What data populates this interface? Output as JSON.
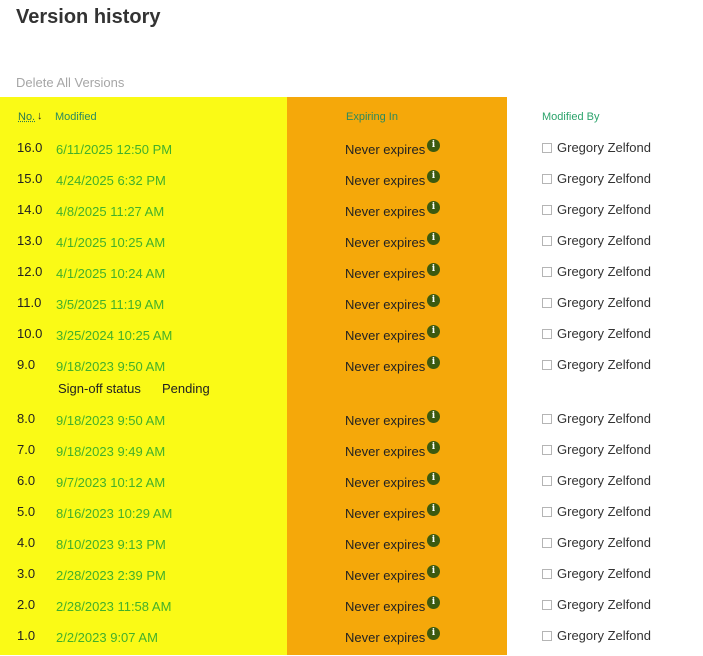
{
  "page": {
    "title": "Version history",
    "delete_all_label": "Delete All Versions"
  },
  "columns": {
    "no": "No.",
    "modified": "Modified",
    "expiring_in": "Expiring In",
    "modified_by": "Modified By"
  },
  "colors": {
    "highlight_yellow": "#fafa16",
    "highlight_orange": "#f5a80a",
    "link_green": "#43b02a"
  },
  "signoff": {
    "label": "Sign-off status",
    "value": "Pending"
  },
  "rows": [
    {
      "no": "16.0",
      "modified": "6/11/2025 12:50 PM",
      "expiring": "Never expires",
      "by": "Gregory Zelfond"
    },
    {
      "no": "15.0",
      "modified": "4/24/2025 6:32 PM",
      "expiring": "Never expires",
      "by": "Gregory Zelfond"
    },
    {
      "no": "14.0",
      "modified": "4/8/2025 11:27 AM",
      "expiring": "Never expires",
      "by": "Gregory Zelfond"
    },
    {
      "no": "13.0",
      "modified": "4/1/2025 10:25 AM",
      "expiring": "Never expires",
      "by": "Gregory Zelfond"
    },
    {
      "no": "12.0",
      "modified": "4/1/2025 10:24 AM",
      "expiring": "Never expires",
      "by": "Gregory Zelfond"
    },
    {
      "no": "11.0",
      "modified": "3/5/2025 11:19 AM",
      "expiring": "Never expires",
      "by": "Gregory Zelfond"
    },
    {
      "no": "10.0",
      "modified": "3/25/2024 10:25 AM",
      "expiring": "Never expires",
      "by": "Gregory Zelfond"
    },
    {
      "no": "9.0",
      "modified": "9/18/2023 9:50 AM",
      "expiring": "Never expires",
      "by": "Gregory Zelfond"
    },
    {
      "no": "8.0",
      "modified": "9/18/2023 9:50 AM",
      "expiring": "Never expires",
      "by": "Gregory Zelfond"
    },
    {
      "no": "7.0",
      "modified": "9/18/2023 9:49 AM",
      "expiring": "Never expires",
      "by": "Gregory Zelfond"
    },
    {
      "no": "6.0",
      "modified": "9/7/2023 10:12 AM",
      "expiring": "Never expires",
      "by": "Gregory Zelfond"
    },
    {
      "no": "5.0",
      "modified": "8/16/2023 10:29 AM",
      "expiring": "Never expires",
      "by": "Gregory Zelfond"
    },
    {
      "no": "4.0",
      "modified": "8/10/2023 9:13 PM",
      "expiring": "Never expires",
      "by": "Gregory Zelfond"
    },
    {
      "no": "3.0",
      "modified": "2/28/2023 2:39 PM",
      "expiring": "Never expires",
      "by": "Gregory Zelfond"
    },
    {
      "no": "2.0",
      "modified": "2/28/2023 11:58 AM",
      "expiring": "Never expires",
      "by": "Gregory Zelfond"
    },
    {
      "no": "1.0",
      "modified": "2/2/2023 9:07 AM",
      "expiring": "Never expires",
      "by": "Gregory Zelfond"
    }
  ]
}
